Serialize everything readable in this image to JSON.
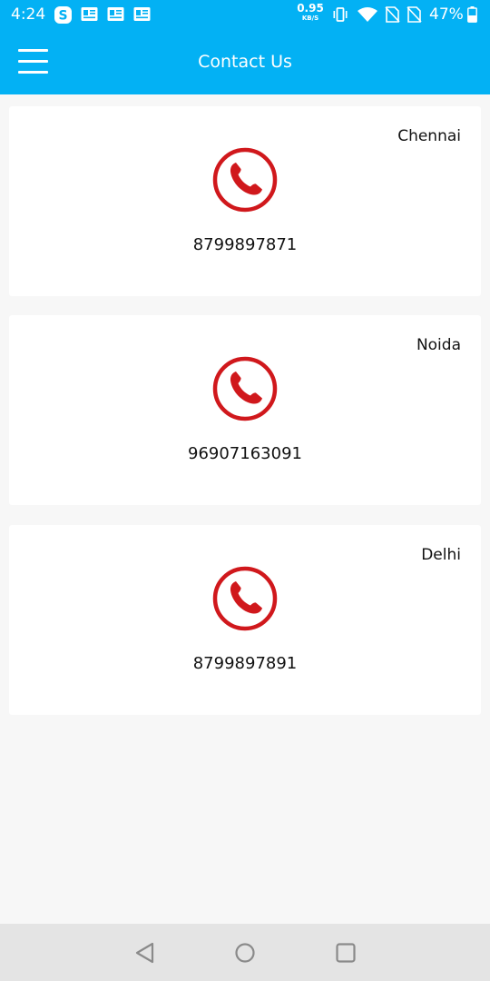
{
  "status_bar": {
    "time": "4:24",
    "network_speed_value": "0.95",
    "network_speed_unit": "KB/S",
    "battery_percent": "47%",
    "notification_icons": [
      "skype-icon",
      "news-icon",
      "news-icon",
      "news-icon"
    ],
    "system_icons": [
      "vibrate-icon",
      "wifi-icon",
      "no-sim-icon",
      "no-sim-icon",
      "battery-icon"
    ]
  },
  "app_bar": {
    "title": "Contact Us",
    "menu_icon": "hamburger-menu-icon",
    "background": "#03b1f4"
  },
  "contacts": [
    {
      "city": "Chennai",
      "phone": "8799897871",
      "icon": "phone-call-icon"
    },
    {
      "city": "Noida",
      "phone": "96907163091",
      "icon": "phone-call-icon"
    },
    {
      "city": "Delhi",
      "phone": "8799897891",
      "icon": "phone-call-icon"
    }
  ],
  "colors": {
    "accent": "#03b1f4",
    "phone_icon": "#d0181c",
    "page_background": "#f7f7f7",
    "card_background": "#ffffff",
    "nav_bar": "#e4e4e4"
  },
  "nav_bar": {
    "buttons": [
      "back-icon",
      "home-icon",
      "recents-icon"
    ]
  }
}
